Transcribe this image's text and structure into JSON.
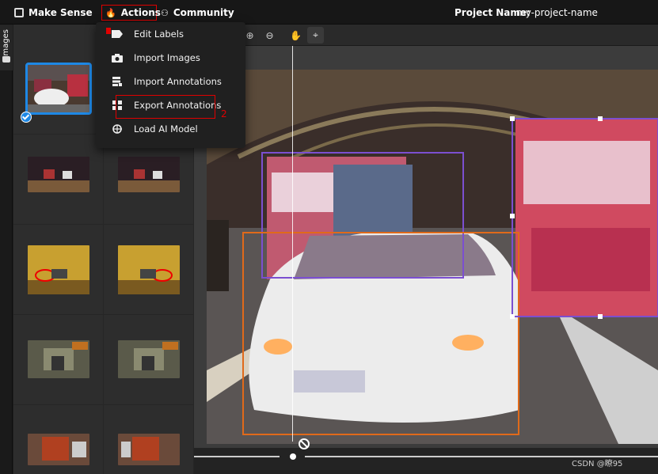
{
  "header": {
    "brand": "Make Sense",
    "actions_label": "Actions",
    "community_label": "Community",
    "project_label": "Project Name:",
    "project_name": "my-project-name"
  },
  "rail": {
    "label": "Images"
  },
  "menu": {
    "items": [
      {
        "label": "Edit Labels",
        "icon": "tag-icon"
      },
      {
        "label": "Import Images",
        "icon": "camera-icon"
      },
      {
        "label": "Import Annotations",
        "icon": "file-import-icon"
      },
      {
        "label": "Export Annotations",
        "icon": "export-icon"
      },
      {
        "label": "Load AI Model",
        "icon": "brain-icon"
      }
    ],
    "step_number": "2"
  },
  "toolbar": {
    "icons": [
      "zoom-in-icon",
      "zoom-out-icon",
      "hand-icon",
      "crosshair-icon"
    ]
  },
  "annotations": {
    "colors": {
      "truck_left": "#7b4fd0",
      "truck_right": "#7b4fd0",
      "car": "#e06a1a"
    }
  },
  "watermark": "CSDN @瞭95",
  "colors": {
    "accent": "#1e88e5",
    "highlight": "#e00000",
    "menu_bg": "#202020"
  }
}
